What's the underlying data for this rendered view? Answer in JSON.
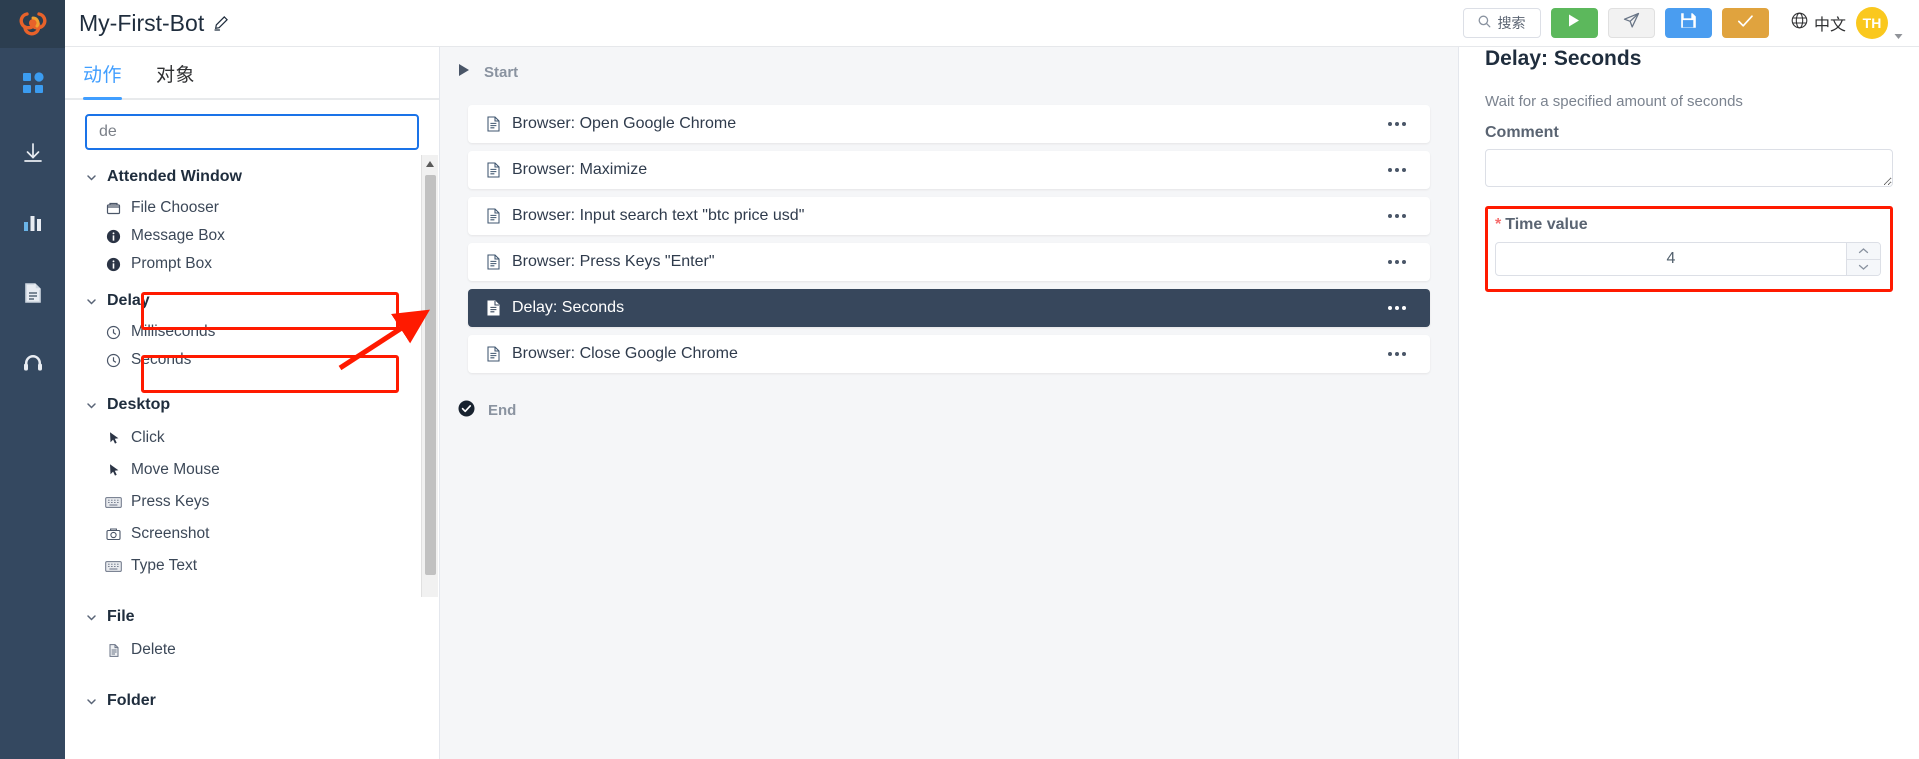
{
  "topbar": {
    "bot_name": "My-First-Bot",
    "edit_icon": "pencil-icon",
    "search_button": "搜索",
    "search_icon": "search-icon",
    "run_icon": "play-icon",
    "deploy_icon": "paper-plane-icon",
    "save_icon": "floppy-disk-icon",
    "confirm_icon": "check-icon",
    "language_icon": "globe-icon",
    "language_label": "中文",
    "avatar_initials": "TH",
    "avatar_caret_icon": "caret-down-icon",
    "colors": {
      "run": "#5cb85c",
      "deploy": "#f2f2f2",
      "save": "#4a9df0",
      "confirm": "#e0a33e",
      "avatar": "#fac81e"
    }
  },
  "rail": {
    "logo_name": "app-logo",
    "items": [
      {
        "name": "dashboard-icon",
        "active": true
      },
      {
        "name": "download-icon",
        "active": false
      },
      {
        "name": "bar-chart-icon",
        "active": false
      },
      {
        "name": "document-icon",
        "active": false
      },
      {
        "name": "headset-icon",
        "active": false
      }
    ]
  },
  "panel": {
    "tabs": [
      {
        "label": "动作",
        "active": true
      },
      {
        "label": "对象",
        "active": false
      }
    ],
    "search_value": "de",
    "search_placeholder": "",
    "groups": [
      {
        "name": "Attended Window",
        "highlighted": false,
        "items": [
          {
            "label": "File Chooser",
            "icon": "folder-icon",
            "highlighted": false
          },
          {
            "label": "Message Box",
            "icon": "info-icon",
            "highlighted": false
          },
          {
            "label": "Prompt Box",
            "icon": "info-icon",
            "highlighted": false
          }
        ]
      },
      {
        "name": "Delay",
        "highlighted": true,
        "items": [
          {
            "label": "Milliseconds",
            "icon": "clock-icon",
            "highlighted": false
          },
          {
            "label": "Seconds",
            "icon": "clock-icon",
            "highlighted": true
          }
        ]
      },
      {
        "name": "Desktop",
        "highlighted": false,
        "items": [
          {
            "label": "Click",
            "icon": "cursor-icon",
            "highlighted": false
          },
          {
            "label": "Move Mouse",
            "icon": "cursor-icon",
            "highlighted": false
          },
          {
            "label": "Press Keys",
            "icon": "keyboard-icon",
            "highlighted": false
          },
          {
            "label": "Screenshot",
            "icon": "camera-icon",
            "highlighted": false
          },
          {
            "label": "Type Text",
            "icon": "keyboard-icon",
            "highlighted": false
          }
        ]
      },
      {
        "name": "File",
        "highlighted": false,
        "items": [
          {
            "label": "Delete",
            "icon": "file-icon",
            "highlighted": false
          }
        ]
      },
      {
        "name": "Folder",
        "highlighted": false,
        "items": []
      }
    ]
  },
  "canvas": {
    "start_label": "Start",
    "start_icon": "play-triangle-icon",
    "end_label": "End",
    "end_icon": "check-circle-icon",
    "steps": [
      {
        "label": "Browser: Open Google Chrome",
        "icon": "file-lines-icon",
        "selected": false
      },
      {
        "label": "Browser: Maximize",
        "icon": "file-lines-icon",
        "selected": false
      },
      {
        "label": "Browser: Input search text \"btc price usd\"",
        "icon": "file-lines-icon",
        "selected": false
      },
      {
        "label": "Browser: Press Keys \"Enter\"",
        "icon": "file-lines-icon",
        "selected": false
      },
      {
        "label": "Delay: Seconds",
        "icon": "file-lines-icon",
        "selected": true
      },
      {
        "label": "Browser: Close Google Chrome",
        "icon": "file-lines-icon",
        "selected": false
      }
    ],
    "row_menu_icon": "ellipsis-icon",
    "selected_row_color": "#37475c"
  },
  "props": {
    "title": "Delay: Seconds",
    "description": "Wait for a specified amount of seconds",
    "comment_label": "Comment",
    "comment_value": "",
    "comment_placeholder": "",
    "time_label": "Time value",
    "time_required_marker": "*",
    "time_value": "4",
    "spin_up_icon": "chevron-up-icon",
    "spin_down_icon": "chevron-down-icon",
    "highlight_color": "#ff1a00"
  }
}
